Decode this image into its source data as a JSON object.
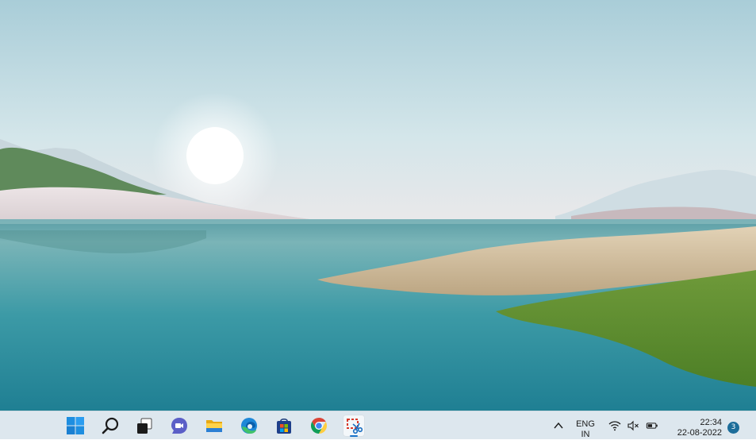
{
  "taskbar": {
    "apps": [
      {
        "name": "Start",
        "icon": "windows-start-icon"
      },
      {
        "name": "Search",
        "icon": "search-icon"
      },
      {
        "name": "Task View",
        "icon": "task-view-icon"
      },
      {
        "name": "Chat",
        "icon": "chat-icon"
      },
      {
        "name": "File Explorer",
        "icon": "folder-icon"
      },
      {
        "name": "Microsoft Edge",
        "icon": "edge-icon"
      },
      {
        "name": "Microsoft Store",
        "icon": "store-icon"
      },
      {
        "name": "Google Chrome",
        "icon": "chrome-icon"
      },
      {
        "name": "Snipping Tool",
        "icon": "snipping-tool-icon",
        "active": true
      }
    ],
    "tray": {
      "language_line1": "ENG",
      "language_line2": "IN",
      "time": "22:34",
      "date": "22-08-2022",
      "notification_count": "3"
    }
  },
  "colors": {
    "taskbar_bg": "#dde7ee",
    "accent": "#1a73c9"
  }
}
